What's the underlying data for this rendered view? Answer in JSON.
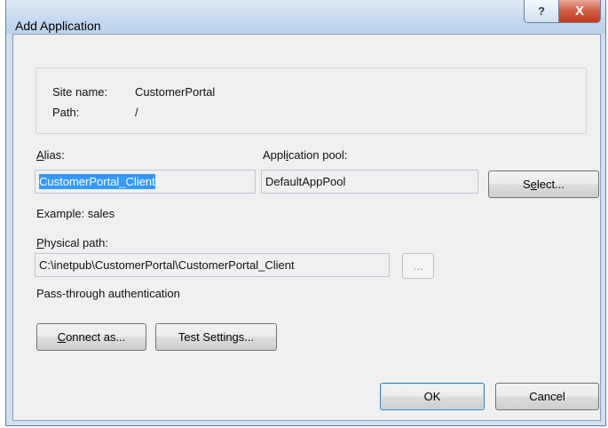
{
  "window": {
    "title": "Add Application",
    "help_glyph": "?",
    "close_glyph": "X"
  },
  "site": {
    "site_name_label": "Site name:",
    "site_name_value": "CustomerPortal",
    "path_label": "Path:",
    "path_value": "/"
  },
  "alias": {
    "label_accel": "A",
    "label_rest": "lias:",
    "value": "CustomerPortal_Client",
    "example": "Example: sales"
  },
  "app_pool": {
    "label_pre": "Appl",
    "label_accel": "i",
    "label_post": "cation pool:",
    "value": "DefaultAppPool",
    "select_pre": "S",
    "select_accel": "e",
    "select_post": "lect..."
  },
  "physical_path": {
    "label_accel": "P",
    "label_rest": "hysical path:",
    "value": "C:\\inetpub\\CustomerPortal\\CustomerPortal_Client",
    "browse_label": "..."
  },
  "auth": {
    "label": "Pass-through authentication",
    "connect_accel": "C",
    "connect_rest": "onnect as...",
    "test_settings_label": "Test Settings..."
  },
  "footer": {
    "ok_label": "OK",
    "cancel_label": "Cancel"
  }
}
